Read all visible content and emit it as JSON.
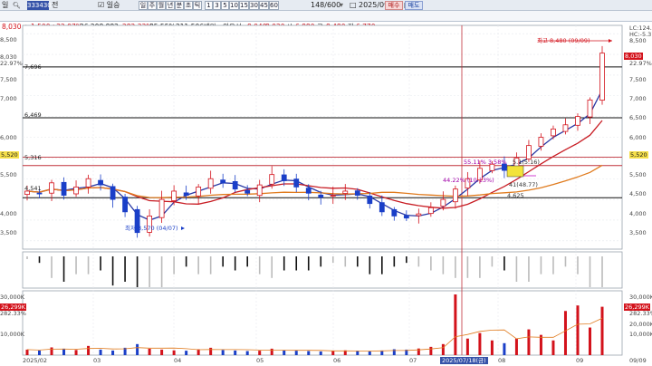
{
  "toolbar": {
    "period_select": "일",
    "code": "333430",
    "name_select": "전",
    "check_label": "일승",
    "period_tabs": [
      "주",
      "월",
      "년",
      "분",
      "초",
      "틱"
    ],
    "intervals": [
      "1",
      "3",
      "5",
      "10",
      "15",
      "30",
      "45",
      "60"
    ],
    "count": "148/600",
    "date": "2025/09/09",
    "buy_label": "매수",
    "sell_label": "매도"
  },
  "quote": {
    "price": "8,030",
    "change": "1,500",
    "change_pct": "+22.97%",
    "volume": "26,298,882",
    "volume_ratio": "282.33%",
    "turnover": "85.55%",
    "amount": "211,506백만",
    "market_label": "외우선",
    "open_price": "8,040",
    "open2": "8,030",
    "low_label": "시",
    "low": "6,880",
    "high_label": "고",
    "high": "8,480",
    "prev_label": "저",
    "prev": "6,770"
  },
  "price_axis": {
    "left_ticks": [
      "8,500",
      "8,000",
      "7,500",
      "7,000",
      "6,500",
      "6,000",
      "5,500",
      "5,000",
      "4,500",
      "4,000",
      "3,500"
    ],
    "right_ticks": [
      "8,500",
      "8,000",
      "7,500",
      "7,000",
      "6,500",
      "6,000",
      "5,500",
      "5,000",
      "4,500",
      "4,000",
      "3,500"
    ],
    "left_current": "8,030",
    "left_current_pct": "22.97%",
    "left_520": "5,520",
    "right_lc": "LC:124.93",
    "right_hc": "HC:-5.31",
    "right_current": "8,030",
    "right_current_pct": "22.97%",
    "right_520": "5,520"
  },
  "levels": [
    {
      "label": "7,696",
      "value": 7696
    },
    {
      "label": "6,469",
      "value": 6469
    },
    {
      "label": "5,316",
      "value": 5316
    },
    {
      "label": "4,541",
      "value": 4541
    }
  ],
  "annotations": {
    "high": "최고 8,480 (09/09)",
    "low": "최저 3,570 (04/07)",
    "a1": "55.11% 3.58%",
    "a2": "5.1(5.16)",
    "a3": "44.22% (10.13%)",
    "a4": "41(48.77)",
    "a5": "4,625"
  },
  "volume_axis": {
    "left_ticks": [
      "30,000K",
      "20,000K",
      "10,000K"
    ],
    "right_ticks": [
      "30,000K",
      "20,000K",
      "10,000K"
    ],
    "left_current": "26,299K",
    "left_pct": "282.33%",
    "right_current": "26,299K",
    "right_pct": "282.33%"
  },
  "x_axis": {
    "labels": [
      "2025/02",
      "03",
      "04",
      "05",
      "06",
      "07",
      "2025/07/18(금)",
      "08",
      "09",
      "09/09"
    ]
  },
  "chart_data": {
    "type": "candlestick",
    "title": "",
    "ylim": [
      3300,
      8700
    ],
    "x": [
      "2025/02",
      "03",
      "04",
      "05",
      "06",
      "07",
      "08",
      "09"
    ],
    "price_close": [
      4700,
      4650,
      4900,
      4600,
      4800,
      5000,
      4850,
      4500,
      4200,
      3700,
      4100,
      4500,
      4700,
      4600,
      4800,
      5000,
      4900,
      4750,
      4650,
      4850,
      5100,
      4950,
      4800,
      4650,
      4550,
      4600,
      4700,
      4600,
      4400,
      4200,
      4100,
      4050,
      4150,
      4300,
      4500,
      4750,
      5000,
      5250,
      5350,
      5200,
      5500,
      5800,
      6000,
      6200,
      6300,
      6500,
      6900,
      8030
    ],
    "lines": [
      {
        "name": "ma_short",
        "color": "#2a3aa6"
      },
      {
        "name": "ma_mid",
        "color": "#c81d24"
      },
      {
        "name": "ma_long",
        "color": "#e07b1e"
      }
    ],
    "volume_ylim": [
      0,
      33000
    ],
    "volume": [
      3000,
      2500,
      4200,
      3500,
      2800,
      5000,
      3000,
      2500,
      4000,
      6000,
      3500,
      3000,
      2600,
      2400,
      3200,
      4000,
      2800,
      2500,
      2200,
      2400,
      3500,
      2600,
      2400,
      2200,
      2000,
      2300,
      2600,
      2200,
      2000,
      2500,
      3200,
      3000,
      3600,
      4500,
      6000,
      33000,
      9000,
      12000,
      8000,
      6500,
      9000,
      14000,
      11000,
      8000,
      24000,
      27000,
      15000,
      26299
    ]
  }
}
